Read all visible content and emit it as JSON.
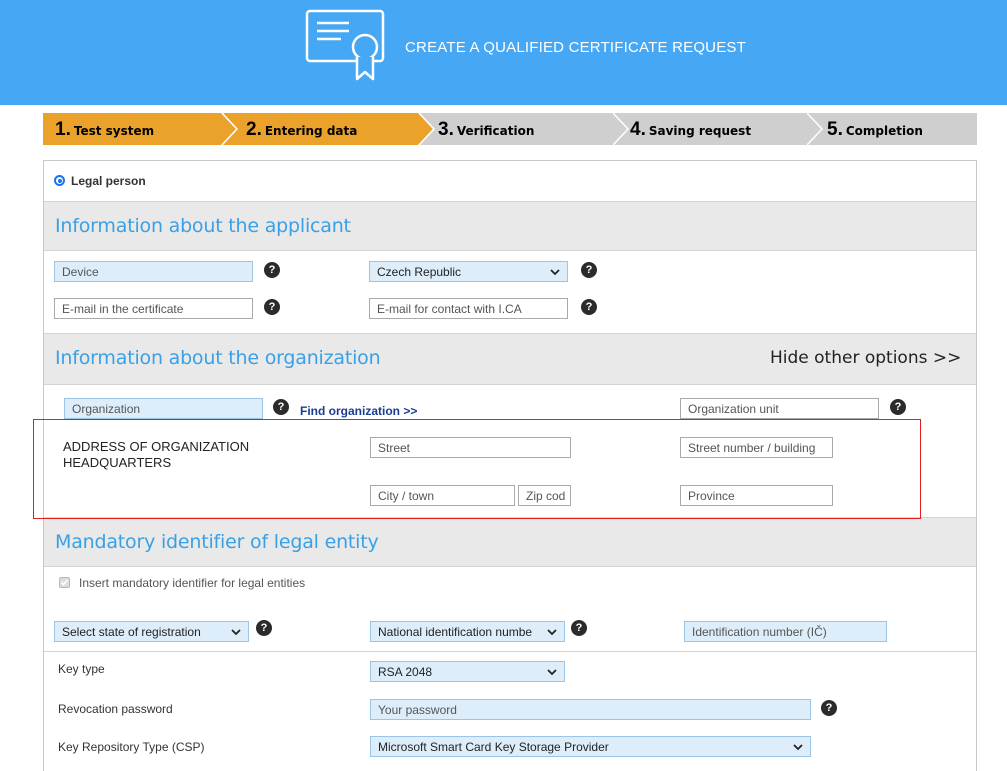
{
  "header": {
    "title": "CREATE A QUALIFIED CERTIFICATE REQUEST",
    "icon": "certificate-icon",
    "background": "#46a8f5"
  },
  "steps": [
    {
      "num": "1.",
      "label": "Test system",
      "state": "done"
    },
    {
      "num": "2.",
      "label": "Entering data",
      "state": "active"
    },
    {
      "num": "3.",
      "label": "Verification",
      "state": "pending"
    },
    {
      "num": "4.",
      "label": "Saving request",
      "state": "pending"
    },
    {
      "num": "5.",
      "label": "Completion",
      "state": "pending"
    }
  ],
  "colors": {
    "step_active": "#eaa22b",
    "step_pending": "#cfcfcf",
    "section_title": "#3aa0e6",
    "highlight": "#e02020"
  },
  "person_type": {
    "label": "Legal person",
    "selected": true
  },
  "applicant": {
    "title": "Information about the applicant",
    "device_placeholder": "Device",
    "country_value": "Czech Republic",
    "email_cert_placeholder": "E-mail in the certificate",
    "email_contact_placeholder": "E-mail for contact with I.CA"
  },
  "organization": {
    "title": "Information about the organization",
    "hide_options": "Hide other options >>",
    "org_placeholder": "Organization",
    "find_org": "Find organization >>",
    "org_unit_placeholder": "Organization unit",
    "address_label": "ADDRESS OF ORGANIZATION HEADQUARTERS",
    "street_placeholder": "Street",
    "street_number_placeholder": "Street number / building",
    "city_placeholder": "City / town",
    "zip_placeholder": "Zip cod",
    "province_placeholder": "Province"
  },
  "legal_id": {
    "title": "Mandatory identifier of legal entity",
    "checkbox_label": "Insert mandatory identifier for legal entities",
    "checkbox_checked": true,
    "state_select": "Select state of registration",
    "id_type_select": "National identification numbe",
    "id_number_placeholder": "Identification number (IČ)"
  },
  "key": {
    "key_type_label": "Key type",
    "key_type_value": "RSA 2048",
    "revocation_label": "Revocation password",
    "revocation_placeholder": "Your password",
    "csp_label": "Key Repository Type (CSP)",
    "csp_value": "Microsoft Smart Card Key Storage Provider"
  }
}
